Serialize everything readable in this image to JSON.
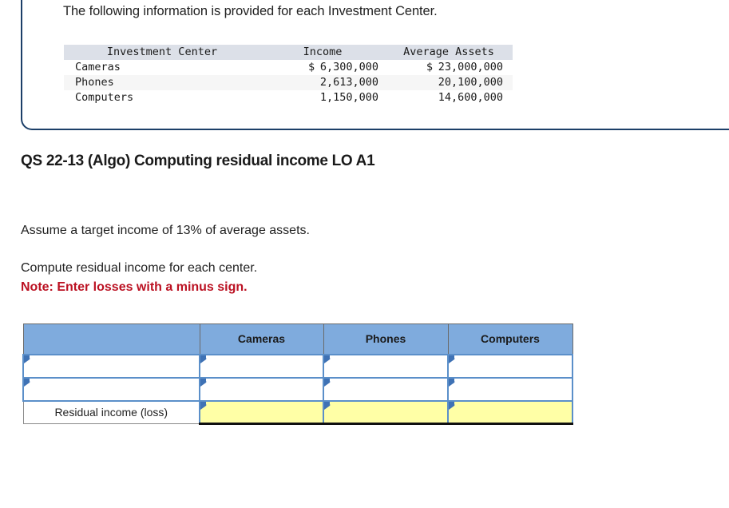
{
  "intro": {
    "text": "The following information is provided for each Investment Center."
  },
  "info_table": {
    "headers": [
      "Investment Center",
      "Income",
      "Average Assets"
    ],
    "rows": [
      {
        "center": "Cameras",
        "income_symbol": "$",
        "income": "6,300,000",
        "assets_symbol": "$",
        "assets": "23,000,000"
      },
      {
        "center": "Phones",
        "income_symbol": "",
        "income": "2,613,000",
        "assets_symbol": "",
        "assets": "20,100,000"
      },
      {
        "center": "Computers",
        "income_symbol": "",
        "income": "1,150,000",
        "assets_symbol": "",
        "assets": "14,600,000"
      }
    ]
  },
  "question": {
    "title": "QS 22-13 (Algo) Computing residual income LO A1",
    "assume": "Assume a target income of 13% of average assets.",
    "compute": "Compute residual income for each center.",
    "note": "Note: Enter losses with a minus sign."
  },
  "answer_grid": {
    "headers": [
      "",
      "Cameras",
      "Phones",
      "Computers"
    ],
    "rows": [
      {
        "label": "",
        "cells": [
          "",
          "",
          ""
        ],
        "highlight": false
      },
      {
        "label": "",
        "cells": [
          "",
          "",
          ""
        ],
        "highlight": false
      },
      {
        "label": "Residual income (loss)",
        "cells": [
          "",
          "",
          ""
        ],
        "highlight": true
      }
    ]
  },
  "colors": {
    "panel_border": "#1c3f68",
    "info_header_bg": "#dce0e8",
    "info_stripe_bg": "#f6f6f6",
    "grid_header_bg": "#7fabdd",
    "grid_cell_border": "#5b8fc9",
    "grid_highlight_bg": "#ffffa6",
    "note_red": "#bb1122"
  }
}
